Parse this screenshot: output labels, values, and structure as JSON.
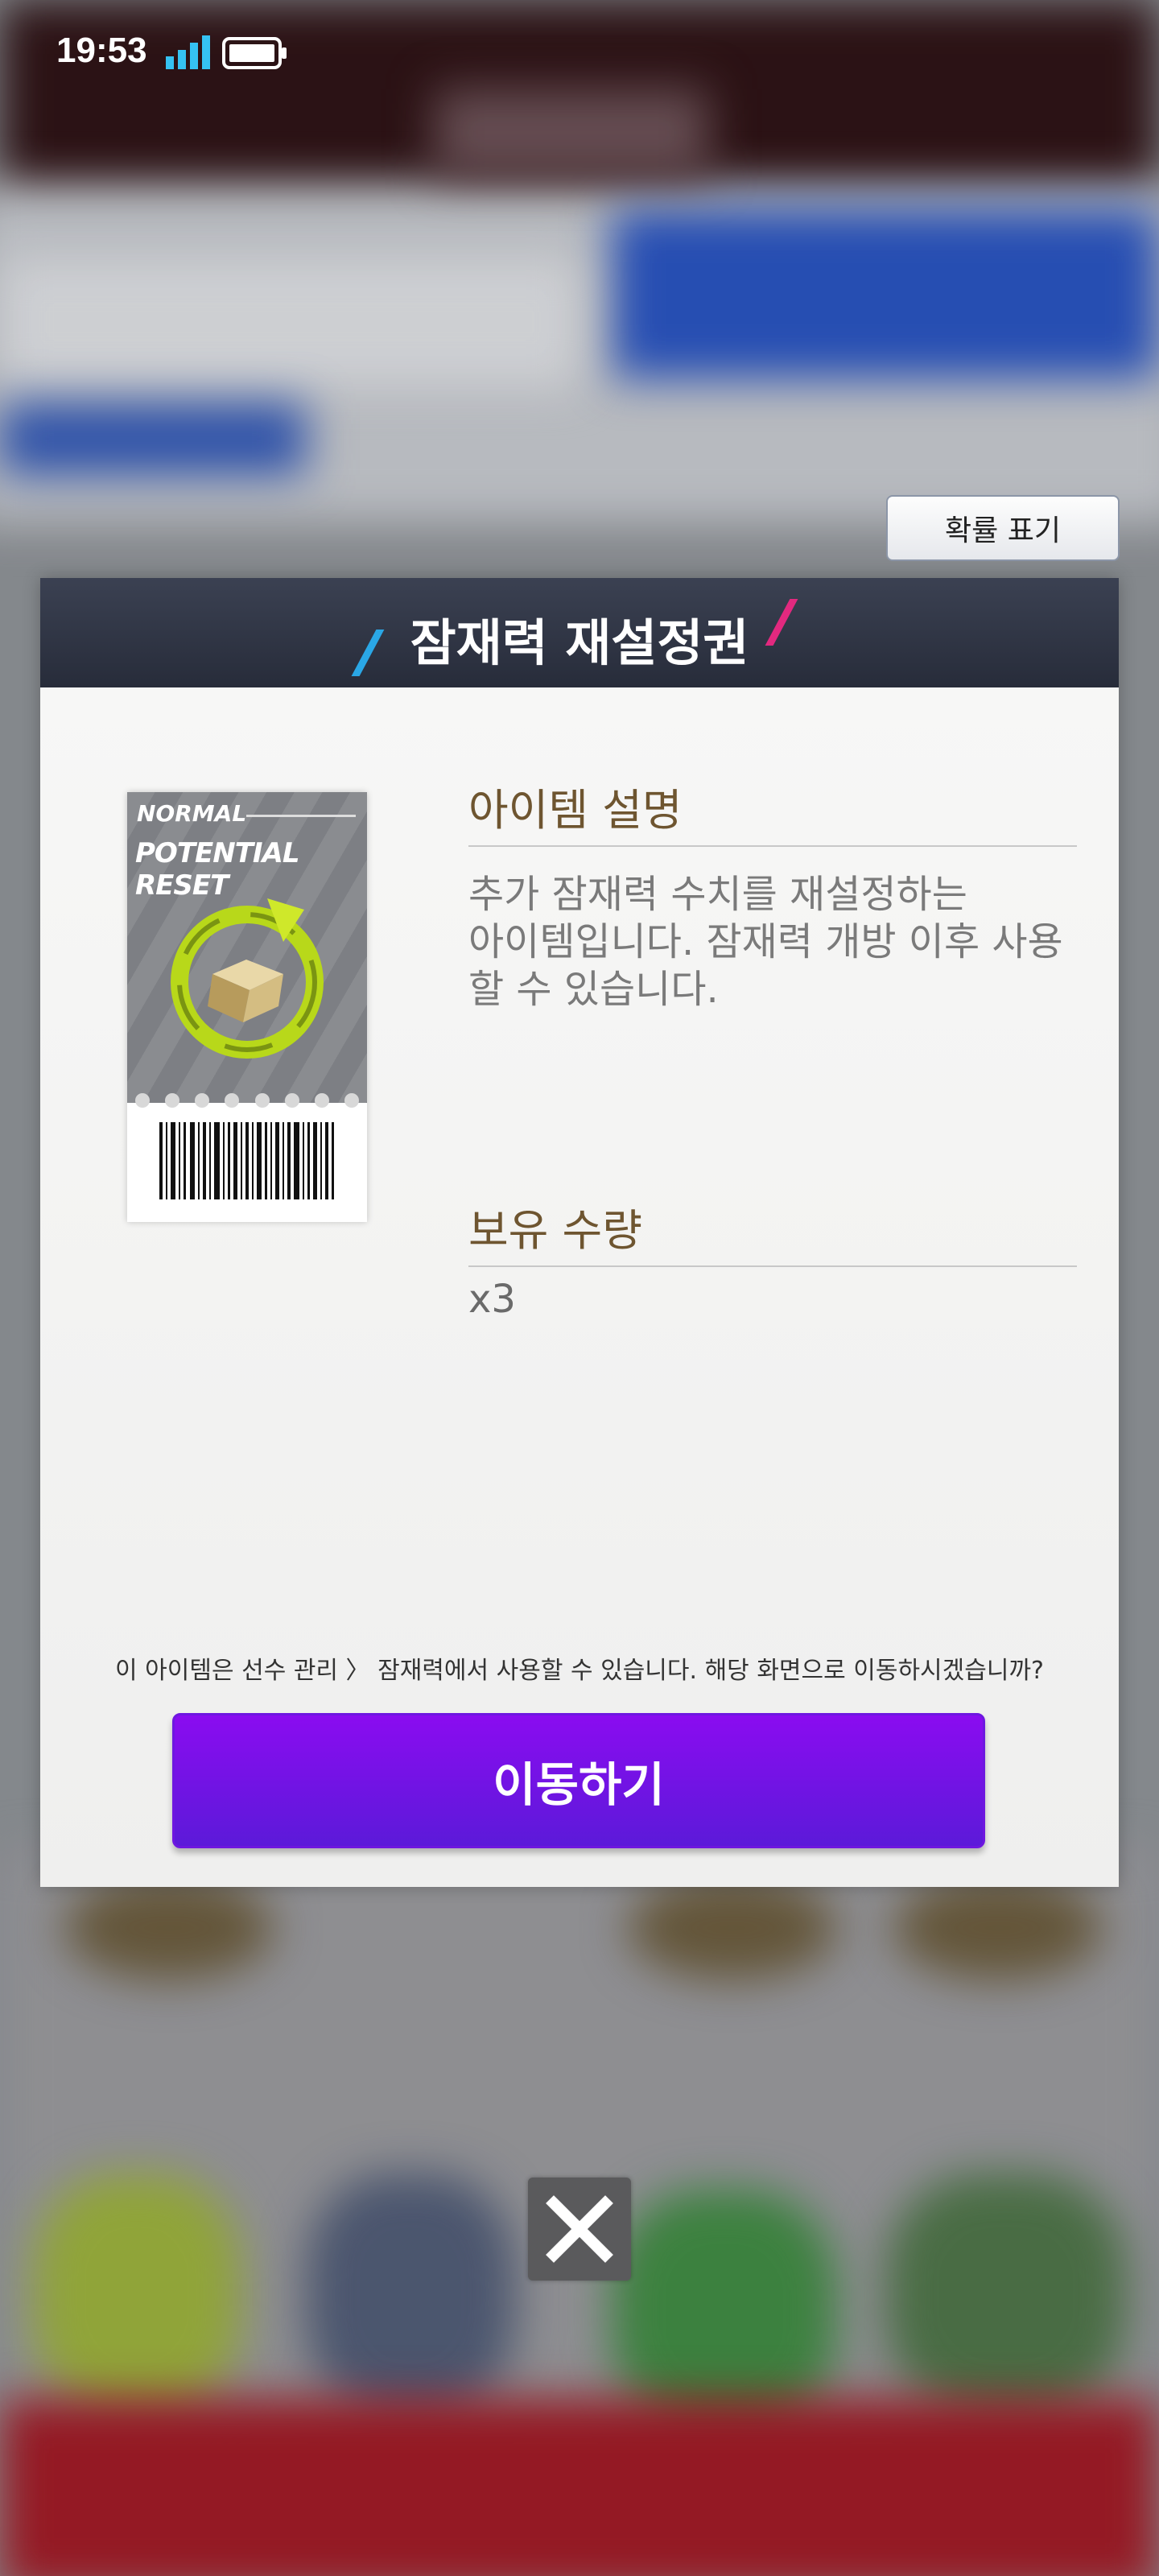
{
  "status_bar": {
    "time": "19:53",
    "signal_icon": "signal-bars-icon",
    "battery_icon": "battery-icon"
  },
  "probability_button": {
    "label": "확률 표기"
  },
  "modal": {
    "title": "잠재력 재설정권",
    "ticket": {
      "grade": "NORMAL",
      "name": "POTENTIAL RESET",
      "icon": "potential-reset-icon"
    },
    "description_title": "아이템 설명",
    "description_lines": [
      "추가 잠재력 수치를 재설정하는",
      "아이템입니다. 잠재력 개방 이후 사용",
      "할 수 있습니다."
    ],
    "quantity_title": "보유 수량",
    "quantity_value": "x3",
    "notice": "이 아이템은 선수 관리 〉 잠재력에서 사용할 수 있습니다. 해당 화면으로 이동하시겠습니까?",
    "move_button_label": "이동하기"
  },
  "close_icon": "close-icon",
  "colors": {
    "header": "#2f3444",
    "accent_purple": "#7a12ea",
    "section_title": "#6e5530",
    "slash_blue": "#2aa7e6",
    "slash_pink": "#e2297f"
  }
}
